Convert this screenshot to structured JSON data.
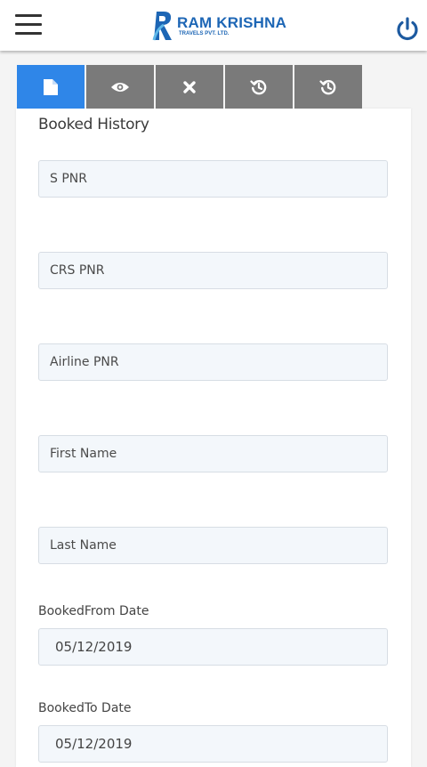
{
  "header": {
    "logo_name": "RAM KRISHNA",
    "logo_sub": "TRAVELS PVT. LTD."
  },
  "tabs": [
    {
      "icon": "document-icon",
      "active": true
    },
    {
      "icon": "eye-icon",
      "active": false
    },
    {
      "icon": "close-icon",
      "active": false
    },
    {
      "icon": "history-icon",
      "active": false
    },
    {
      "icon": "history-icon",
      "active": false
    }
  ],
  "form": {
    "title": "Booked History",
    "s_pnr_placeholder": "S PNR",
    "crs_pnr_placeholder": "CRS PNR",
    "airline_pnr_placeholder": "Airline PNR",
    "first_name_placeholder": "First Name",
    "last_name_placeholder": "Last Name",
    "from_date_label": "BookedFrom Date",
    "from_date_value": "05/12/2019",
    "to_date_label": "BookedTo Date",
    "to_date_value": "05/12/2019"
  },
  "colors": {
    "brand": "#1d66b5",
    "tab_active": "#2f86e8",
    "tab_inactive": "#7a7a7a"
  }
}
